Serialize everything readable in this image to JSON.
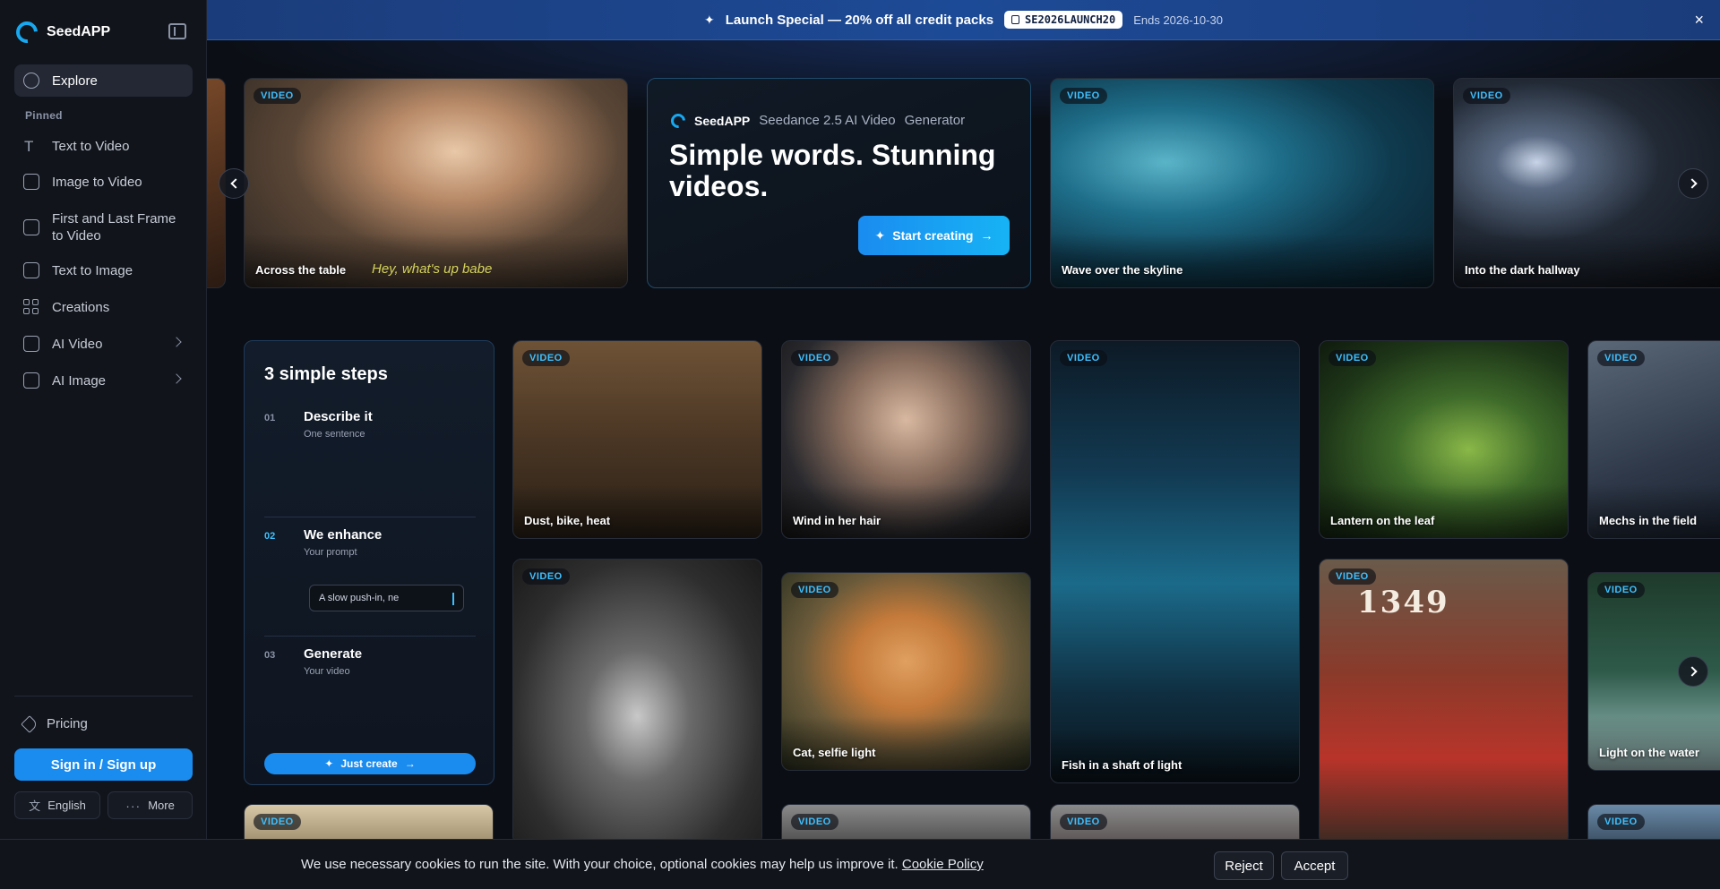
{
  "sidebar": {
    "brand": "SeedAPP",
    "explore": "Explore",
    "pinned_label": "Pinned",
    "items": [
      {
        "label": "Text to Video"
      },
      {
        "label": "Image to Video"
      },
      {
        "label": "First and Last Frame to Video"
      },
      {
        "label": "Text to Image"
      },
      {
        "label": "Creations"
      },
      {
        "label": "AI Video"
      },
      {
        "label": "AI Image"
      }
    ],
    "pricing": "Pricing",
    "signin": "Sign in / Sign up",
    "language": "English",
    "more": "More"
  },
  "banner": {
    "text": "Launch Special — 20% off all credit packs",
    "code": "SE2026LAUNCH20",
    "ends": "Ends 2026-10-30",
    "close": "×"
  },
  "hero": {
    "brand": "SeedAPP",
    "product": "Seedance 2.5 AI Video",
    "product_suffix": "Generator",
    "title": "Simple words. Stunning videos.",
    "cta": "Start creating"
  },
  "tag": "VIDEO",
  "top_cards": [
    {
      "title": "Across the table",
      "subtitle": "Hey, what's up babe"
    },
    {
      "title": "Wave over the skyline"
    },
    {
      "title": "Into the dark hallway"
    }
  ],
  "steps": {
    "title": "3 simple steps",
    "items": [
      {
        "num": "01",
        "head": "Describe it",
        "sub": "One sentence"
      },
      {
        "num": "02",
        "head": "We enhance",
        "sub": "Your prompt"
      },
      {
        "num": "03",
        "head": "Generate",
        "sub": "Your video"
      }
    ],
    "prompt": "A slow push-in, ne",
    "cta": "Just create"
  },
  "grid_cards": [
    {
      "title": "Dust, bike, heat"
    },
    {
      "title": "Wind in her hair"
    },
    {
      "title": "Fish in a shaft of light"
    },
    {
      "title": "Lantern on the leaf"
    },
    {
      "title": "Mechs in the field"
    },
    {
      "title": "Cat, selfie light"
    },
    {
      "title": "Light on the water"
    }
  ],
  "couple_text": "1349",
  "cookie": {
    "text": "We use necessary cookies to run the site. With your choice, optional cookies may help us improve it.",
    "link": "Cookie Policy",
    "reject": "Reject",
    "accept": "Accept"
  }
}
